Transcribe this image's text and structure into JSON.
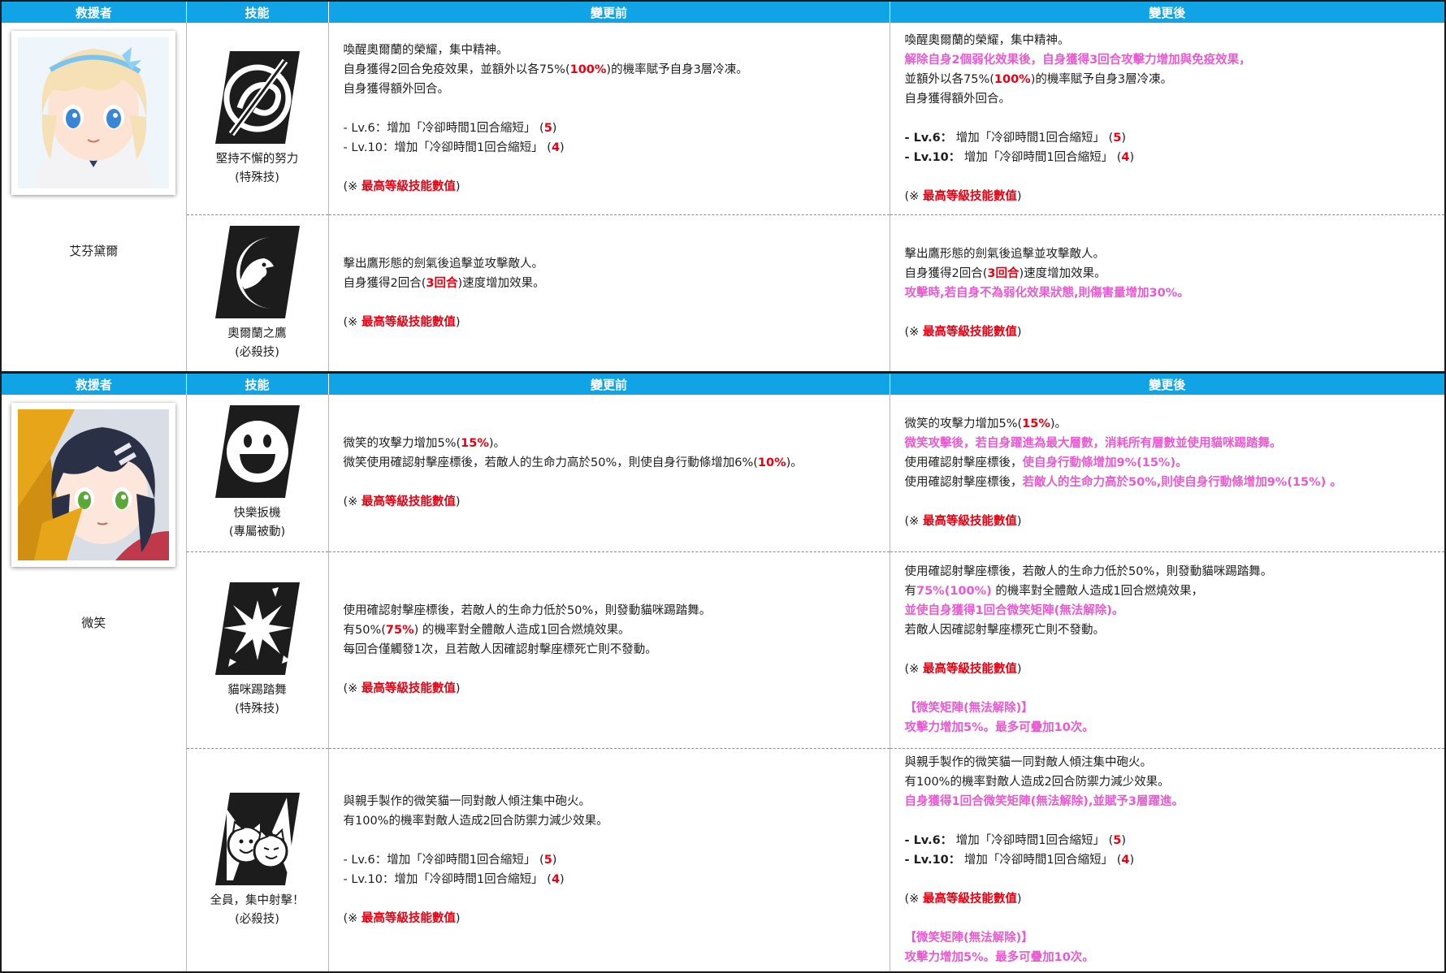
{
  "colors": {
    "header_bg": "#10a4e6",
    "highlight_red": "#e60012",
    "highlight_pink": "#e85ad0"
  },
  "headers": {
    "rescuer": "救援者",
    "skill": "技能",
    "before": "變更前",
    "after": "變更後"
  },
  "characters": [
    {
      "name": "艾芬黛爾",
      "portrait": "blonde-girl-portrait",
      "skills": [
        {
          "icon": "sword-through-swirl-icon",
          "name": "堅持不懈的努力",
          "type": "(特殊技)",
          "before": [
            [
              [
                "n",
                "喚醒奧爾蘭的榮耀，集中精神。"
              ]
            ],
            [
              [
                "n",
                "自身獲得2回合免疫效果，並額外以各75%("
              ],
              [
                "r",
                "100%"
              ],
              [
                "n",
                ")的機率賦予自身3層冷凍。"
              ]
            ],
            [
              [
                "n",
                "自身獲得額外回合。"
              ]
            ],
            [],
            [
              [
                "n",
                "- Lv.6：增加「冷卻時間1回合縮短」 ("
              ],
              [
                "r",
                "5"
              ],
              [
                "n",
                ")"
              ]
            ],
            [
              [
                "n",
                "- Lv.10：增加「冷卻時間1回合縮短」 ("
              ],
              [
                "r",
                "4"
              ],
              [
                "n",
                ")"
              ]
            ],
            [],
            [
              [
                "n",
                "(※ "
              ],
              [
                "r",
                "最高等級技能數值"
              ],
              [
                "n",
                ")"
              ]
            ]
          ],
          "after": [
            [
              [
                "n",
                "喚醒奧爾蘭的榮耀，集中精神。"
              ]
            ],
            [
              [
                "p",
                "解除自身2個弱化效果後，自身獲得3回合攻擊力增加與免疫效果，"
              ]
            ],
            [
              [
                "n",
                "並額外以各75%("
              ],
              [
                "r",
                "100%"
              ],
              [
                "n",
                ")的機率賦予自身3層冷凍。"
              ]
            ],
            [
              [
                "n",
                "自身獲得額外回合。"
              ]
            ],
            [],
            [
              [
                "b",
                "- Lv.6："
              ],
              [
                "n",
                " 增加「冷卻時間1回合縮短」 ("
              ],
              [
                "r",
                "5"
              ],
              [
                "n",
                ")"
              ]
            ],
            [
              [
                "b",
                "- Lv.10："
              ],
              [
                "n",
                " 增加「冷卻時間1回合縮短」 ("
              ],
              [
                "r",
                "4"
              ],
              [
                "n",
                ")"
              ]
            ],
            [],
            [
              [
                "n",
                "(※ "
              ],
              [
                "r",
                "最高等級技能數值"
              ],
              [
                "n",
                ")"
              ]
            ]
          ]
        },
        {
          "icon": "eagle-crescent-icon",
          "name": "奧爾蘭之鷹",
          "type": "(必殺技)",
          "before": [
            [
              [
                "n",
                "擊出鷹形態的劍氣後追擊並攻擊敵人。"
              ]
            ],
            [
              [
                "n",
                "自身獲得2回合("
              ],
              [
                "r",
                "3回合"
              ],
              [
                "n",
                ")速度增加效果。"
              ]
            ],
            [],
            [
              [
                "n",
                "(※ "
              ],
              [
                "r",
                "最高等級技能數值"
              ],
              [
                "n",
                ")"
              ]
            ]
          ],
          "after": [
            [
              [
                "n",
                "擊出鷹形態的劍氣後追擊並攻擊敵人。"
              ]
            ],
            [
              [
                "n",
                "自身獲得2回合("
              ],
              [
                "r",
                "3回合"
              ],
              [
                "n",
                ")速度增加效果。"
              ]
            ],
            [
              [
                "p",
                "攻擊時,若自身不為弱化效果狀態,則傷害量增加30%。"
              ]
            ],
            [],
            [
              [
                "n",
                "(※ "
              ],
              [
                "r",
                "最高等級技能數值"
              ],
              [
                "n",
                ")"
              ]
            ]
          ]
        }
      ]
    },
    {
      "name": "微笑",
      "portrait": "dark-haired-girl-portrait",
      "skills": [
        {
          "icon": "smiley-face-icon",
          "name": "快樂扳機",
          "type": "(專屬被動)",
          "before": [
            [
              [
                "n",
                "微笑的攻擊力增加5%("
              ],
              [
                "r",
                "15%"
              ],
              [
                "n",
                ")。"
              ]
            ],
            [
              [
                "n",
                "微笑使用確認射擊座標後，若敵人的生命力高於50%，則使自身行動條增加6%("
              ],
              [
                "r",
                "10%"
              ],
              [
                "n",
                ")。"
              ]
            ],
            [],
            [
              [
                "n",
                "(※ "
              ],
              [
                "r",
                "最高等級技能數值"
              ],
              [
                "n",
                ")"
              ]
            ]
          ],
          "after": [
            [
              [
                "n",
                "微笑的攻擊力增加5%("
              ],
              [
                "r",
                "15%"
              ],
              [
                "n",
                ")。"
              ]
            ],
            [
              [
                "p",
                "微笑攻擊後，若自身躍進為最大層數，消耗所有層數並使用貓咪踢踏舞。"
              ]
            ],
            [
              [
                "n",
                "使用確認射擊座標後，"
              ],
              [
                "p",
                "使自身行動條增加9%(15%)。"
              ]
            ],
            [
              [
                "n",
                "使用確認射擊座標後，"
              ],
              [
                "p",
                "若敵人的生命力高於50%,則使自身行動條增加9%(15%) 。"
              ]
            ],
            [],
            [
              [
                "n",
                "(※ "
              ],
              [
                "r",
                "最高等級技能數值"
              ],
              [
                "n",
                ")"
              ]
            ]
          ]
        },
        {
          "icon": "burst-explosion-icon",
          "name": "貓咪踢踏舞",
          "type": "(特殊技)",
          "before": [
            [
              [
                "n",
                "使用確認射擊座標後，若敵人的生命力低於50%，則發動貓咪踢踏舞。"
              ]
            ],
            [
              [
                "n",
                "有50%("
              ],
              [
                "r",
                "75%"
              ],
              [
                "n",
                ") 的機率對全體敵人造成1回合燃燒效果。"
              ]
            ],
            [
              [
                "n",
                "每回合僅觸發1次，且若敵人因確認射擊座標死亡則不發動。"
              ]
            ],
            [],
            [
              [
                "n",
                "(※ "
              ],
              [
                "r",
                "最高等級技能數值"
              ],
              [
                "n",
                ")"
              ]
            ]
          ],
          "after": [
            [
              [
                "n",
                "使用確認射擊座標後，若敵人的生命力低於50%，則發動貓咪踢踏舞。"
              ]
            ],
            [
              [
                "n",
                "有"
              ],
              [
                "p",
                "75%(100%)"
              ],
              [
                "n",
                " 的機率對全體敵人造成1回合燃燒效果，"
              ]
            ],
            [
              [
                "p",
                "並使自身獲得1回合微笑矩陣(無法解除)。"
              ]
            ],
            [
              [
                "n",
                "若敵人因確認射擊座標死亡則不發動。"
              ]
            ],
            [],
            [
              [
                "n",
                "(※ "
              ],
              [
                "r",
                "最高等級技能數值"
              ],
              [
                "n",
                ")"
              ]
            ],
            [],
            [
              [
                "p",
                "【微笑矩陣(無法解除)】"
              ]
            ],
            [
              [
                "p",
                "攻擊力增加5%。最多可疊加10次。"
              ]
            ]
          ]
        },
        {
          "icon": "cat-faces-icon",
          "name": "全員，集中射擊！",
          "type": "(必殺技)",
          "before": [
            [
              [
                "n",
                "與親手製作的微笑貓一同對敵人傾注集中砲火。"
              ]
            ],
            [
              [
                "n",
                "有100%的機率對敵人造成2回合防禦力減少效果。"
              ]
            ],
            [],
            [
              [
                "n",
                "- Lv.6：增加「冷卻時間1回合縮短」 ("
              ],
              [
                "r",
                "5"
              ],
              [
                "n",
                ")"
              ]
            ],
            [
              [
                "n",
                "- Lv.10：增加「冷卻時間1回合縮短」 ("
              ],
              [
                "r",
                "4"
              ],
              [
                "n",
                ")"
              ]
            ],
            [],
            [
              [
                "n",
                "(※ "
              ],
              [
                "r",
                "最高等級技能數值"
              ],
              [
                "n",
                ")"
              ]
            ]
          ],
          "after": [
            [
              [
                "n",
                "與親手製作的微笑貓一同對敵人傾注集中砲火。"
              ]
            ],
            [
              [
                "n",
                "有100%的機率對敵人造成2回合防禦力減少效果。"
              ]
            ],
            [
              [
                "p",
                "自身獲得1回合微笑矩陣(無法解除),並賦予3層躍進。"
              ]
            ],
            [],
            [
              [
                "b",
                "- Lv.6："
              ],
              [
                "n",
                " 增加「冷卻時間1回合縮短」 ("
              ],
              [
                "r",
                "5"
              ],
              [
                "n",
                ")"
              ]
            ],
            [
              [
                "b",
                "- Lv.10："
              ],
              [
                "n",
                " 增加「冷卻時間1回合縮短」 ("
              ],
              [
                "r",
                "4"
              ],
              [
                "n",
                ")"
              ]
            ],
            [],
            [
              [
                "n",
                "(※ "
              ],
              [
                "r",
                "最高等級技能數值"
              ],
              [
                "n",
                ")"
              ]
            ],
            [],
            [
              [
                "p",
                "【微笑矩陣(無法解除)】"
              ]
            ],
            [
              [
                "p",
                "攻擊力增加5%。最多可疊加10次。"
              ]
            ]
          ]
        }
      ]
    }
  ]
}
